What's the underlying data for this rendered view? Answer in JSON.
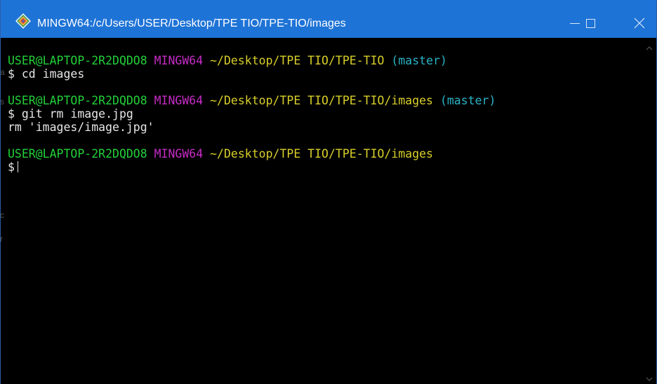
{
  "window": {
    "title": "MINGW64:/c/Users/USER/Desktop/TPE TIO/TPE-TIO/images",
    "controls": {
      "minimize": "minimize",
      "maximize": "maximize",
      "close": "close"
    }
  },
  "terminal": {
    "blocks": [
      {
        "prompt": {
          "user": "USER@LAPTOP-2R2DQDO8",
          "shell": "MINGW64",
          "path": "~/Desktop/TPE TIO/TPE-TIO",
          "branch": "(master)"
        },
        "command": "$ cd images",
        "output": []
      },
      {
        "prompt": {
          "user": "USER@LAPTOP-2R2DQDO8",
          "shell": "MINGW64",
          "path": "~/Desktop/TPE TIO/TPE-TIO/images",
          "branch": "(master)"
        },
        "command": "$ git rm image.jpg",
        "output": [
          "rm 'images/image.jpg'"
        ]
      },
      {
        "prompt": {
          "user": "USER@LAPTOP-2R2DQDO8",
          "shell": "MINGW64",
          "path": "~/Desktop/TPE TIO/TPE-TIO/images",
          "branch": ""
        },
        "command": "$",
        "output": []
      }
    ]
  },
  "colors": {
    "titlebar": "#1e73d6",
    "user": "#23d13a",
    "shell": "#c72bc7",
    "path": "#d8cf2a",
    "branch": "#2ab4c7",
    "text": "#e6e6e6",
    "background": "#000000"
  },
  "background_bleed": [
    "a",
    "s",
    "c",
    "r"
  ]
}
